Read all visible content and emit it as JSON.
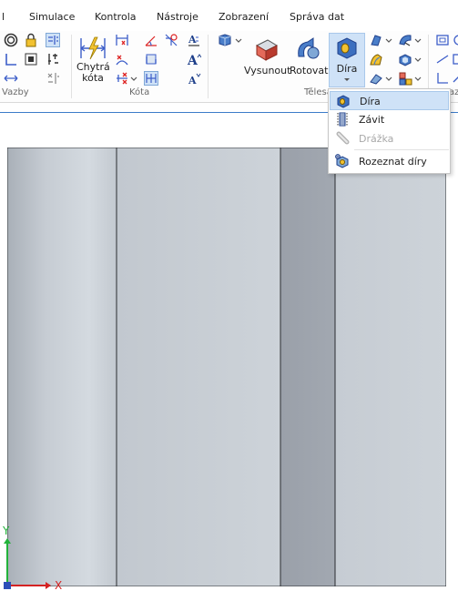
{
  "menu": {
    "items": [
      {
        "label": "l"
      },
      {
        "label": "Simulace"
      },
      {
        "label": "Kontrola"
      },
      {
        "label": "Nástroje"
      },
      {
        "label": "Zobrazení"
      },
      {
        "label": "Správa dat"
      }
    ]
  },
  "ribbon": {
    "groups": {
      "vazby": "Vazby",
      "kota": "Kóta",
      "telesa": "Tělesa",
      "cut": "az"
    },
    "buttons": {
      "chytra_kota_line1": "Chytrá",
      "chytra_kota_line2": "kóta",
      "vysunout": "Vysunout",
      "rotovat": "Rotovat",
      "dira": "Díra"
    }
  },
  "dropdown": {
    "items": [
      {
        "label": "Díra",
        "state": "selected",
        "icon": "hole-icon"
      },
      {
        "label": "Závit",
        "state": "normal",
        "icon": "thread-icon"
      },
      {
        "label": "Drážka",
        "state": "disabled",
        "icon": "slot-icon"
      },
      {
        "label": "Rozeznat díry",
        "state": "normal",
        "icon": "recognize-holes-icon"
      }
    ]
  },
  "triad": {
    "x_label": "X",
    "y_label": "Y"
  },
  "colors": {
    "accent": "#3d7cc9",
    "selection": "#cfe2f7",
    "part_face": "#c4cbd3",
    "part_dark_face": "#9ea4ad"
  }
}
